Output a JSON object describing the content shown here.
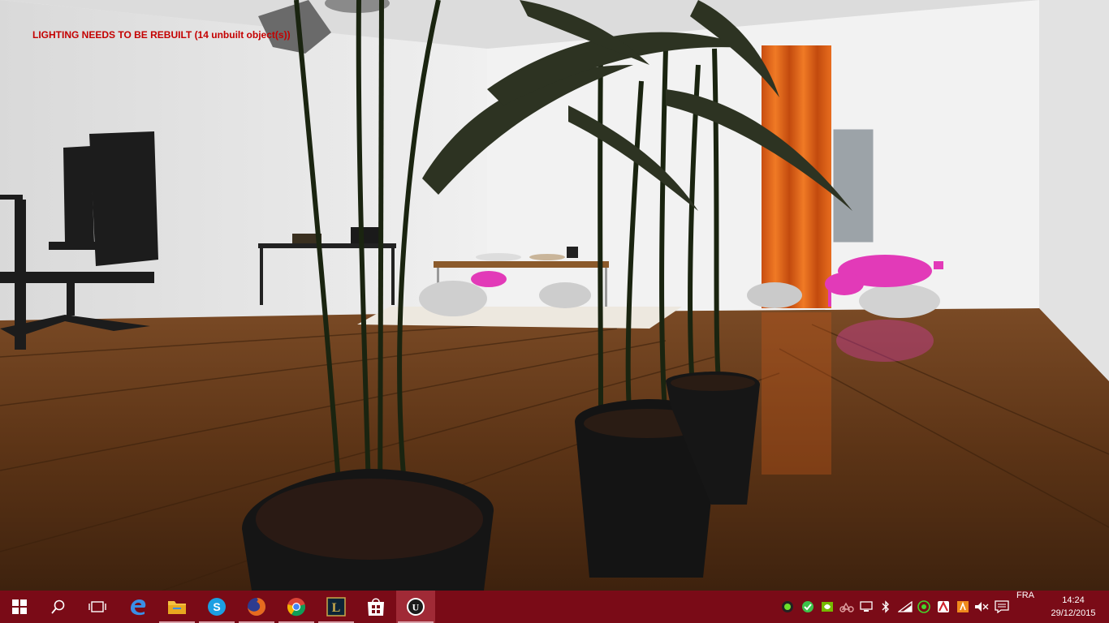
{
  "viewport": {
    "warning_text": "LIGHTING NEEDS TO BE REBUILT (14 unbuilt object(s))"
  },
  "colors": {
    "taskbar": "#7a0b17",
    "taskbar_active": "#a02a36",
    "warning": "#c40000",
    "floor": "#6a3d1c",
    "curtain": "#e0611a",
    "wall": "#eaeaea",
    "pot": "#1a1a1a",
    "crab": "#e23ab8"
  },
  "taskbar": {
    "buttons": [
      {
        "name": "start-button",
        "icon": "windows-logo-icon"
      },
      {
        "name": "search-button",
        "icon": "search-icon"
      },
      {
        "name": "task-view-button",
        "icon": "task-view-icon"
      },
      {
        "name": "edge-button",
        "icon": "edge-icon"
      },
      {
        "name": "file-explorer-button",
        "icon": "folder-icon"
      },
      {
        "name": "skype-button",
        "icon": "skype-icon"
      },
      {
        "name": "firefox-button",
        "icon": "firefox-icon"
      },
      {
        "name": "chrome-button",
        "icon": "chrome-icon"
      },
      {
        "name": "league-of-legends-button",
        "icon": "league-icon"
      },
      {
        "name": "store-button",
        "icon": "store-icon"
      },
      {
        "name": "unreal-engine-button",
        "icon": "unreal-icon"
      }
    ],
    "tray_icons": [
      "green-circle-icon",
      "green-badge-icon",
      "nvidia-icon",
      "bike-icon",
      "network-display-icon",
      "bluetooth-icon",
      "wifi-icon",
      "razer-icon",
      "antivirus-icon",
      "avast-icon",
      "volume-muted-icon",
      "action-center-icon"
    ],
    "language": "FRA",
    "time": "14:24",
    "date": "29/12/2015"
  }
}
